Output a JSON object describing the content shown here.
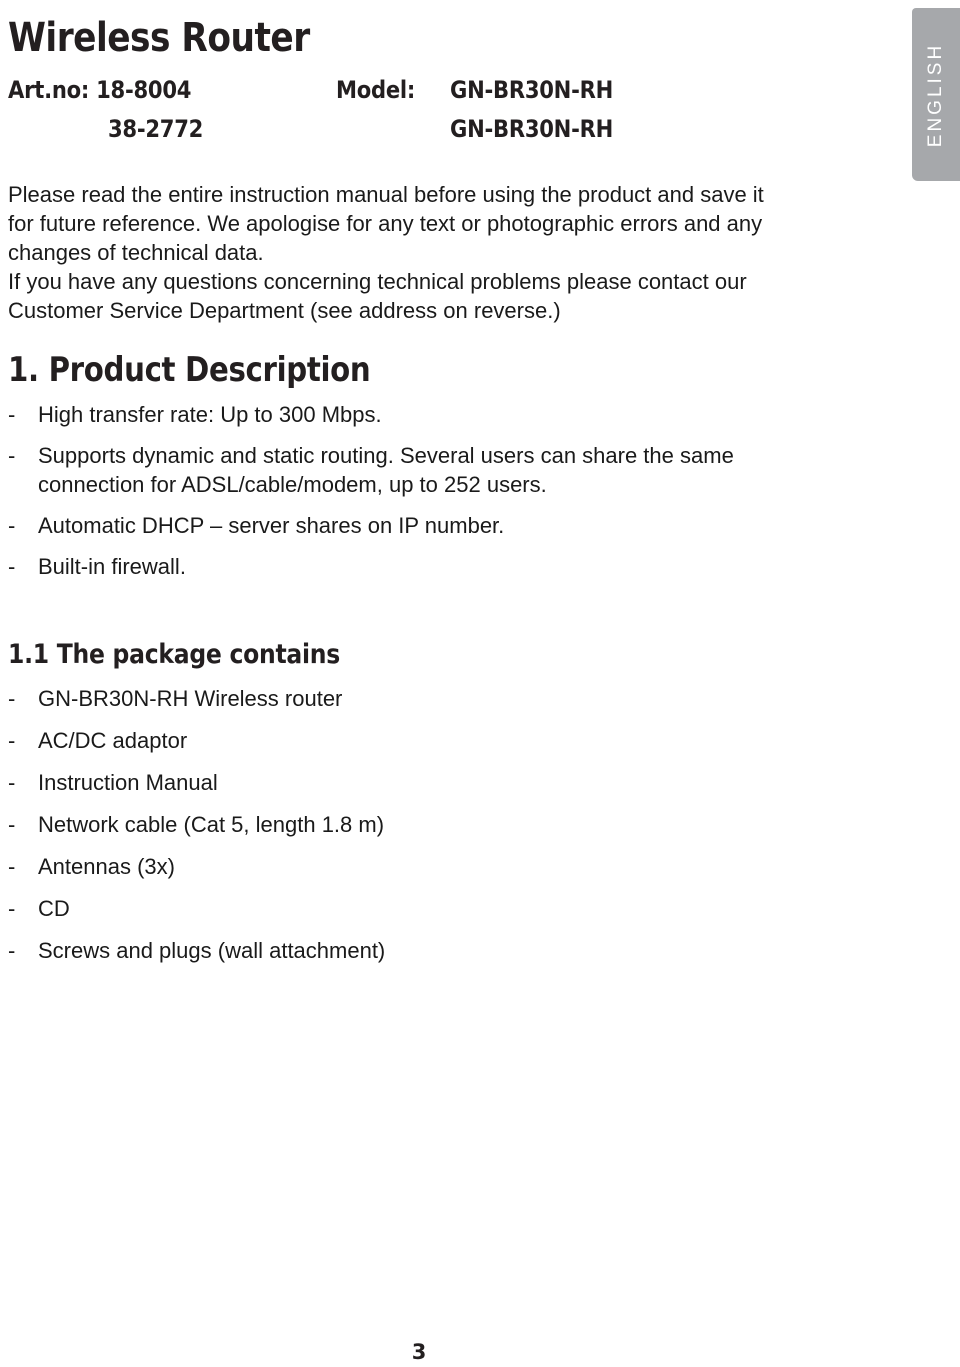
{
  "document": {
    "title": "Wireless Router",
    "language_tab": "ENGLISH",
    "page_number": "3"
  },
  "product_info": {
    "art_no_label_and_value": "Art.no: 18-8004",
    "art_no_second": "38-2772",
    "model_label": "Model:",
    "model_value_1": "GN-BR30N-RH",
    "model_value_2": "GN-BR30N-RH"
  },
  "intro": {
    "line1": "Please read the entire instruction manual before using the product and save it",
    "line2": "for future reference. We apologise for any text or photographic errors and any",
    "line3": "changes of technical data.",
    "line4": "If you have any questions concerning technical problems please contact our",
    "line5": "Customer Service Department (see address on reverse.)"
  },
  "sections": {
    "product_description": {
      "heading": "1. Product Description",
      "bullet_marker": "-",
      "items": [
        "High transfer rate:  Up to 300 Mbps.",
        "Supports dynamic and static routing.  Several users can share the same connection for ADSL/cable/modem, up to 252 users.",
        "Automatic DHCP – server shares on IP number.",
        "Built-in firewall."
      ]
    },
    "package_contains": {
      "heading": "1.1 The package contains",
      "bullet_marker": "-",
      "items": [
        "GN-BR30N-RH Wireless router",
        "AC/DC adaptor",
        "Instruction Manual",
        "Network cable (Cat 5, length 1.8 m)",
        "Antennas (3x)",
        "CD",
        "Screws and plugs (wall attachment)"
      ]
    }
  },
  "colors": {
    "tab_background": "#a6a8ab",
    "tab_text": "#ffffff",
    "heading_text": "#231f20",
    "body_text": "#1a1a1a",
    "page_background": "#ffffff"
  }
}
